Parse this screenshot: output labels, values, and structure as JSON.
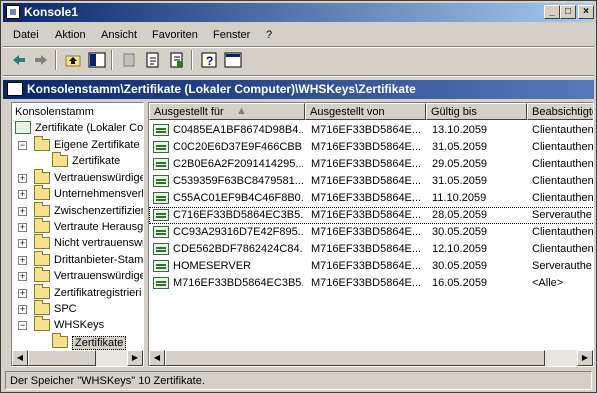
{
  "window": {
    "title": "Konsole1",
    "minimize": "_",
    "maximize": "□",
    "close": "×"
  },
  "menu": [
    "Datei",
    "Aktion",
    "Ansicht",
    "Favoriten",
    "Fenster",
    "?"
  ],
  "path": "Konsolenstamm\\Zertifikate (Lokaler Computer)\\WHSKeys\\Zertifikate",
  "tree": {
    "root": "Konsolenstamm",
    "computer": "Zertifikate (Lokaler Co",
    "items": [
      {
        "label": "Eigene Zertifikate",
        "expanded": true
      },
      {
        "label": "Zertifikate",
        "child": true
      },
      {
        "label": "Vertrauenswürdige"
      },
      {
        "label": "Unternehmensverl"
      },
      {
        "label": "Zwischenzertifizier"
      },
      {
        "label": "Vertraute Herausg"
      },
      {
        "label": "Nicht vertrauenswi"
      },
      {
        "label": "Drittanbieter-Stam"
      },
      {
        "label": "Vertrauenswürdige"
      },
      {
        "label": "Zertifikatregistrieri"
      },
      {
        "label": "SPC"
      },
      {
        "label": "WHSKeys",
        "expanded": true
      },
      {
        "label": "Zertifikate",
        "child": true,
        "selected": true
      }
    ]
  },
  "columns": [
    "Ausgestellt für",
    "Ausgestellt von",
    "Gültig bis",
    "Beabsichtigte"
  ],
  "rows": [
    {
      "for": "C0485EA1BF8674D98B4...",
      "by": "M716EF33BD5864E...",
      "until": "13.10.2059",
      "purpose": "Clientauthen"
    },
    {
      "for": "C0C20E6D37E9F466CBB...",
      "by": "M716EF33BD5864E...",
      "until": "31.05.2059",
      "purpose": "Clientauthen"
    },
    {
      "for": "C2B0E6A2F2091414295...",
      "by": "M716EF33BD5864E...",
      "until": "29.05.2059",
      "purpose": "Clientauthen"
    },
    {
      "for": "C539359F63BC8479581...",
      "by": "M716EF33BD5864E...",
      "until": "31.05.2059",
      "purpose": "Clientauthen"
    },
    {
      "for": "C55AC01EF9B4C46F8B0...",
      "by": "M716EF33BD5864E...",
      "until": "11.10.2059",
      "purpose": "Clientauthen"
    },
    {
      "for": "C716EF33BD5864EC3B5...",
      "by": "M716EF33BD5864E...",
      "until": "28.05.2059",
      "purpose": "Serverauthe"
    },
    {
      "for": "CC93A29316D7E42F895...",
      "by": "M716EF33BD5864E...",
      "until": "30.05.2059",
      "purpose": "Clientauthen"
    },
    {
      "for": "CDE562BDF7862424C84...",
      "by": "M716EF33BD5864E...",
      "until": "12.10.2059",
      "purpose": "Clientauthen"
    },
    {
      "for": "HOMESERVER",
      "by": "M716EF33BD5864E...",
      "until": "30.05.2059",
      "purpose": "Serverauthe"
    },
    {
      "for": "M716EF33BD5864EC3B5...",
      "by": "M716EF33BD5864E...",
      "until": "16.05.2059",
      "purpose": "<Alle>"
    }
  ],
  "status": "Der Speicher \"WHSKeys\" 10 Zertifikate."
}
